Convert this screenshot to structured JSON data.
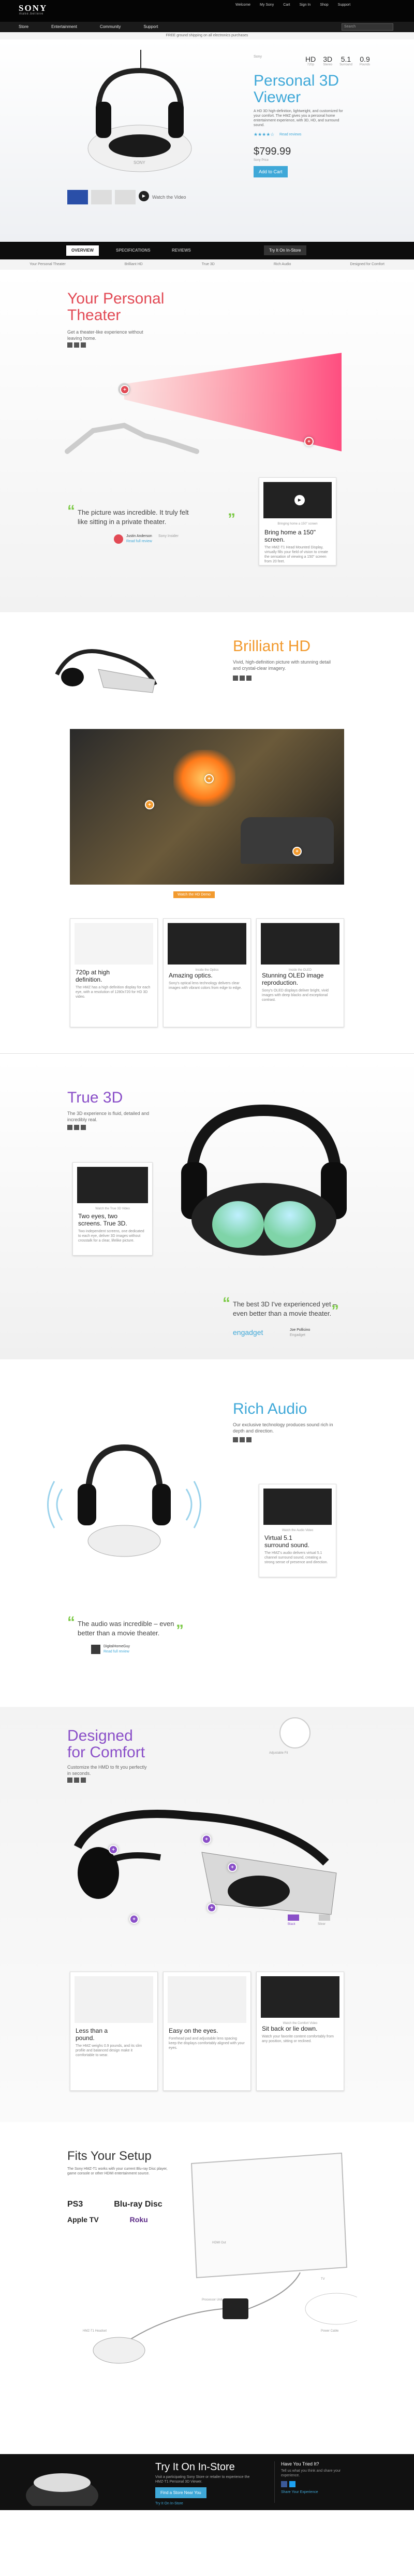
{
  "header": {
    "logo": "SONY",
    "tagline": "make.believe",
    "top_links": [
      "Welcome",
      "My Sony",
      "Cart",
      "Sign In",
      "Shop",
      "Support"
    ],
    "nav": [
      "Store",
      "Entertainment",
      "Community",
      "Support"
    ],
    "search_placeholder": "Search",
    "promo": "FREE ground shipping on all electronics purchases"
  },
  "hero": {
    "badge": "Sony",
    "title_line1": "Personal 3D",
    "title_line2": "Viewer",
    "specs": [
      {
        "value": "HD",
        "label": "720p"
      },
      {
        "value": "3D",
        "label": "Stereo"
      },
      {
        "value": "5.1",
        "label": "Surround"
      },
      {
        "value": "0.9",
        "label": "Pounds"
      }
    ],
    "description": "A HD 3D high-definition, lightweight, and customized for your comfort. The HMZ gives you a personal home entertainment experience, with 3D, HD, and surround sound.",
    "review_link": "Read reviews",
    "price": "$799.99",
    "price_label": "Sony Price",
    "add_to_cart": "Add to Cart",
    "video_label": "Watch the Video"
  },
  "tabs": {
    "items": [
      "OVERVIEW",
      "SPECIFICATIONS",
      "REVIEWS"
    ],
    "cta": "Try It On In-Store",
    "subtabs": [
      "Your Personal Theater",
      "Brilliant HD",
      "True 3D",
      "Rich Audio",
      "Designed for Comfort"
    ]
  },
  "theater": {
    "title1": "Your Personal",
    "title2": "Theater",
    "sub": "Get a theater-like experience without leaving home.",
    "card_video_label": "Bringing home a 150\" screen",
    "card_title1": "Bring home a 150\"",
    "card_title2": "screen.",
    "card_text": "The HMZ-T1 Head Mounted Display, virtually fills your field of vision to create the sensation of viewing a 150\" screen from 20 feet.",
    "quote1": "The picture was incredible. It truly felt",
    "quote2": "like sitting in a private theater.",
    "author": "Justin Anderson",
    "author_role": "Sony Insider",
    "author_link": "Read full review"
  },
  "hd": {
    "title": "Brilliant HD",
    "sub": "Vivid, high-definition picture with stunning detail and crystal-clear imagery.",
    "player_label": "Watch the HD Demo",
    "cards": [
      {
        "title1": "720p at high",
        "title2": "definition.",
        "text": "The HMZ has a high definition display for each eye, with a resolution of 1280x720 for HD 3D video.",
        "label": ""
      },
      {
        "title1": "Amazing optics.",
        "title2": "",
        "text": "Sony's optical lens technology delivers clear images with vibrant colors from edge to edge.",
        "label": "Inside the Optics"
      },
      {
        "title1": "Stunning OLED image",
        "title2": "reproduction.",
        "text": "Sony's OLED displays deliver bright, vivid images with deep blacks and exceptional contrast.",
        "label": "Inside the OLED"
      }
    ]
  },
  "true3d": {
    "title": "True 3D",
    "sub": "The 3D experience is fluid, detailed and incredibly real.",
    "card_label": "Watch the True 3D Video",
    "card_title1": "Two eyes, two",
    "card_title2": "screens. True 3D.",
    "card_text": "Two independent screens, one dedicated to each eye, deliver 3D images without crosstalk for a clear, lifelike picture.",
    "quote1": "The best 3D I've experienced yet –",
    "quote2": "even better than a movie theater.",
    "source": "engadget",
    "author": "Joe Pollicino",
    "author_role": "Engadget"
  },
  "audio": {
    "title": "Rich Audio",
    "sub": "Our exclusive technology produces sound rich in depth and direction.",
    "card_label": "Watch the Audio Video",
    "card_title1": "Virtual 5.1",
    "card_title2": "surround sound.",
    "card_text": "The HMZ's audio delivers virtual 5.1 channel surround sound, creating a strong sense of presence and direction.",
    "quote1": "The audio was incredible – even",
    "quote2": "better than a movie theater.",
    "author": "DigitalHomeGuy",
    "author_link": "Read full review"
  },
  "comfort": {
    "title1": "Designed",
    "title2": "for Comfort",
    "sub": "Customize the HMD to fit you perfectly in seconds.",
    "swatch_label": "Adjustable Fit",
    "variants": [
      "Black",
      "Silver"
    ],
    "cards": [
      {
        "title1": "Less than a",
        "title2": "pound.",
        "text": "The HMZ weighs 0.9 pounds, and its slim profile and balanced design make it comfortable to wear.",
        "label": ""
      },
      {
        "title1": "Easy on the eyes.",
        "title2": "",
        "text": "Forehead pad and adjustable lens spacing keep the displays comfortably aligned with your eyes.",
        "label": ""
      },
      {
        "title1": "Sit back or lie down.",
        "title2": "",
        "text": "Watch your favorite content comfortably from any position, sitting or reclined.",
        "label": "Watch the Comfort Video"
      }
    ]
  },
  "fit": {
    "title": "Fits Your Setup",
    "sub": "The Sony HMZ-T1 works with your current Blu-ray Disc player, game console or other HDMI entertainment source.",
    "devices": [
      "PS3",
      "Apple TV",
      "Blu-ray Disc",
      "Roku"
    ],
    "diagram_labels": [
      "HDMI Out",
      "Processor Unit",
      "HMZ-T1 Headset",
      "TV",
      "Power Cable"
    ]
  },
  "footer": {
    "title": "Try It On In-Store",
    "sub": "Visit a participating Sony Store or retailer to experience the HMZ-T1 Personal 3D Viewer.",
    "cta": "Find a Store Near You",
    "cta2": "Try It On In-Store",
    "social_title": "Have You Tried It?",
    "social_text": "Tell us what you think and share your experience.",
    "social_cta": "Share Your Experience",
    "colors": {
      "accent": "#3fa8d8",
      "red": "#e24a55",
      "orange": "#f29a2e",
      "purple": "#8a4fc8",
      "green": "#7ac943"
    }
  }
}
